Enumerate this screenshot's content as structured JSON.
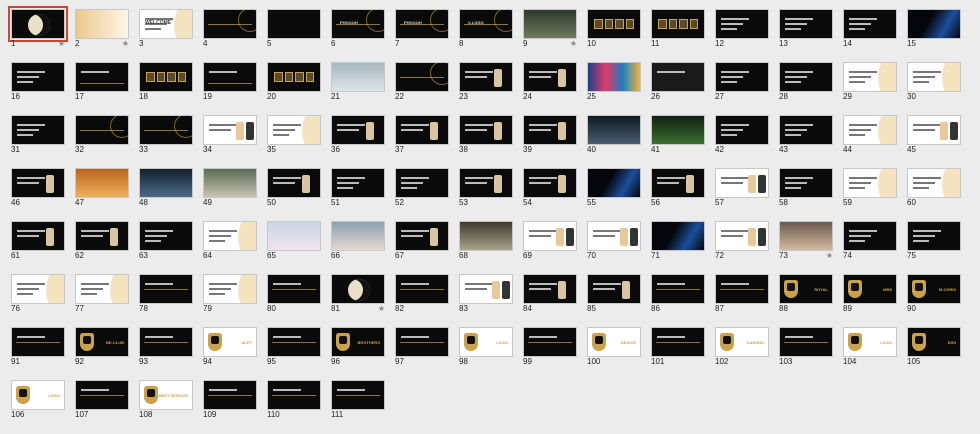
{
  "slides": [
    {
      "n": "1",
      "k": "moon",
      "sel": true,
      "star": true
    },
    {
      "n": "2",
      "k": "goldglow",
      "star": true
    },
    {
      "n": "3",
      "k": "lighttitle",
      "label": "WELCOME"
    },
    {
      "n": "4",
      "k": "darkarc"
    },
    {
      "n": "5",
      "k": "darkicon"
    },
    {
      "n": "6",
      "k": "darkarc",
      "label": "PHOOOH"
    },
    {
      "n": "7",
      "k": "darkarc",
      "label": "PHOOOH"
    },
    {
      "n": "8",
      "k": "darkarc",
      "label": "V-LOGO"
    },
    {
      "n": "9",
      "k": "photo",
      "c1": "#2d3a2a",
      "c2": "#6f7a60",
      "star": true
    },
    {
      "n": "10",
      "k": "boxes"
    },
    {
      "n": "11",
      "k": "boxes"
    },
    {
      "n": "12",
      "k": "darktext"
    },
    {
      "n": "13",
      "k": "darkcards"
    },
    {
      "n": "14",
      "k": "darkcards"
    },
    {
      "n": "15",
      "k": "darkblue"
    },
    {
      "n": "16",
      "k": "darktext"
    },
    {
      "n": "17",
      "k": "darkchart"
    },
    {
      "n": "18",
      "k": "boxes"
    },
    {
      "n": "19",
      "k": "darkchart"
    },
    {
      "n": "20",
      "k": "boxes"
    },
    {
      "n": "21",
      "k": "photo",
      "c1": "#a8b7bf",
      "c2": "#dfe5e8"
    },
    {
      "n": "22",
      "k": "darkarc"
    },
    {
      "n": "23",
      "k": "darkphone"
    },
    {
      "n": "24",
      "k": "darkphone"
    },
    {
      "n": "25",
      "k": "collage"
    },
    {
      "n": "26",
      "k": "faces"
    },
    {
      "n": "27",
      "k": "darktext"
    },
    {
      "n": "28",
      "k": "darktext"
    },
    {
      "n": "29",
      "k": "light"
    },
    {
      "n": "30",
      "k": "light"
    },
    {
      "n": "31",
      "k": "darktext"
    },
    {
      "n": "32",
      "k": "darkarc"
    },
    {
      "n": "33",
      "k": "darkarc"
    },
    {
      "n": "34",
      "k": "phoneslight"
    },
    {
      "n": "35",
      "k": "light"
    },
    {
      "n": "36",
      "k": "darkphoto"
    },
    {
      "n": "37",
      "k": "darkphoto"
    },
    {
      "n": "38",
      "k": "darkphone"
    },
    {
      "n": "39",
      "k": "darkphone"
    },
    {
      "n": "40",
      "k": "photo",
      "c1": "#0f1a24",
      "c2": "#4a5d6f"
    },
    {
      "n": "41",
      "k": "photo",
      "c1": "#122012",
      "c2": "#3b6f2f"
    },
    {
      "n": "42",
      "k": "darktext"
    },
    {
      "n": "43",
      "k": "darktext"
    },
    {
      "n": "44",
      "k": "light"
    },
    {
      "n": "45",
      "k": "phoneslight"
    },
    {
      "n": "46",
      "k": "darkphone"
    },
    {
      "n": "47",
      "k": "photo",
      "c1": "#b8641e",
      "c2": "#f1b15a"
    },
    {
      "n": "48",
      "k": "photo",
      "c1": "#15202c",
      "c2": "#4b6b8a"
    },
    {
      "n": "49",
      "k": "photo",
      "c1": "#5a6b55",
      "c2": "#c7c4b2"
    },
    {
      "n": "50",
      "k": "darkphone"
    },
    {
      "n": "51",
      "k": "darktext"
    },
    {
      "n": "52",
      "k": "darktext"
    },
    {
      "n": "53",
      "k": "darkphone"
    },
    {
      "n": "54",
      "k": "darkphone"
    },
    {
      "n": "55",
      "k": "darkblue"
    },
    {
      "n": "56",
      "k": "darkphone"
    },
    {
      "n": "57",
      "k": "phoneslight"
    },
    {
      "n": "58",
      "k": "darktext"
    },
    {
      "n": "59",
      "k": "lightblue"
    },
    {
      "n": "60",
      "k": "light"
    },
    {
      "n": "61",
      "k": "darkphoto"
    },
    {
      "n": "62",
      "k": "darkphone"
    },
    {
      "n": "63",
      "k": "darkcards"
    },
    {
      "n": "64",
      "k": "light"
    },
    {
      "n": "65",
      "k": "photo",
      "c1": "#c9d6e6",
      "c2": "#f1e3ef"
    },
    {
      "n": "66",
      "k": "photo",
      "c1": "#8aa2b4",
      "c2": "#e6d9cf"
    },
    {
      "n": "67",
      "k": "darkphone"
    },
    {
      "n": "68",
      "k": "photo",
      "c1": "#3d3a2c",
      "c2": "#a8a48c"
    },
    {
      "n": "69",
      "k": "phoneslight"
    },
    {
      "n": "70",
      "k": "phoneslight"
    },
    {
      "n": "71",
      "k": "darkblue"
    },
    {
      "n": "72",
      "k": "phoneslight"
    },
    {
      "n": "73",
      "k": "photo",
      "c1": "#6b5a4f",
      "c2": "#d3b9a0",
      "star": true
    },
    {
      "n": "74",
      "k": "darktext"
    },
    {
      "n": "75",
      "k": "darktext"
    },
    {
      "n": "76",
      "k": "light"
    },
    {
      "n": "77",
      "k": "light"
    },
    {
      "n": "78",
      "k": "darkline"
    },
    {
      "n": "79",
      "k": "light"
    },
    {
      "n": "80",
      "k": "darkline"
    },
    {
      "n": "81",
      "k": "moon",
      "star": true
    },
    {
      "n": "82",
      "k": "darkline"
    },
    {
      "n": "83",
      "k": "phoneslight"
    },
    {
      "n": "84",
      "k": "darkphone"
    },
    {
      "n": "85",
      "k": "darkphone"
    },
    {
      "n": "86",
      "k": "darkline"
    },
    {
      "n": "87",
      "k": "darkline"
    },
    {
      "n": "88",
      "k": "award",
      "label": "ROYAL"
    },
    {
      "n": "89",
      "k": "award",
      "label": "MRS"
    },
    {
      "n": "90",
      "k": "award",
      "label": "M-CHRIS"
    },
    {
      "n": "91",
      "k": "darkline"
    },
    {
      "n": "92",
      "k": "award",
      "label": "BE-CLUB"
    },
    {
      "n": "93",
      "k": "darkline"
    },
    {
      "n": "94",
      "k": "lightaward",
      "label": "ALPT"
    },
    {
      "n": "95",
      "k": "darkline"
    },
    {
      "n": "96",
      "k": "award",
      "label": "BROTHERS"
    },
    {
      "n": "97",
      "k": "darkline"
    },
    {
      "n": "98",
      "k": "lightaward",
      "label": "LOGO"
    },
    {
      "n": "99",
      "k": "darkline"
    },
    {
      "n": "100",
      "k": "lightaward",
      "label": "ADVICE"
    },
    {
      "n": "101",
      "k": "darkline"
    },
    {
      "n": "102",
      "k": "lightaward",
      "label": "KASUNO"
    },
    {
      "n": "103",
      "k": "darkline"
    },
    {
      "n": "104",
      "k": "lightaward",
      "label": "LOGO"
    },
    {
      "n": "105",
      "k": "award",
      "label": "DIGI"
    },
    {
      "n": "106",
      "k": "lightaward",
      "label": "LOGO"
    },
    {
      "n": "107",
      "k": "darkline"
    },
    {
      "n": "108",
      "k": "lightaward",
      "label": "BEST SERVICE"
    },
    {
      "n": "109",
      "k": "darkline"
    },
    {
      "n": "110",
      "k": "darkline"
    },
    {
      "n": "111",
      "k": "darkline"
    }
  ]
}
